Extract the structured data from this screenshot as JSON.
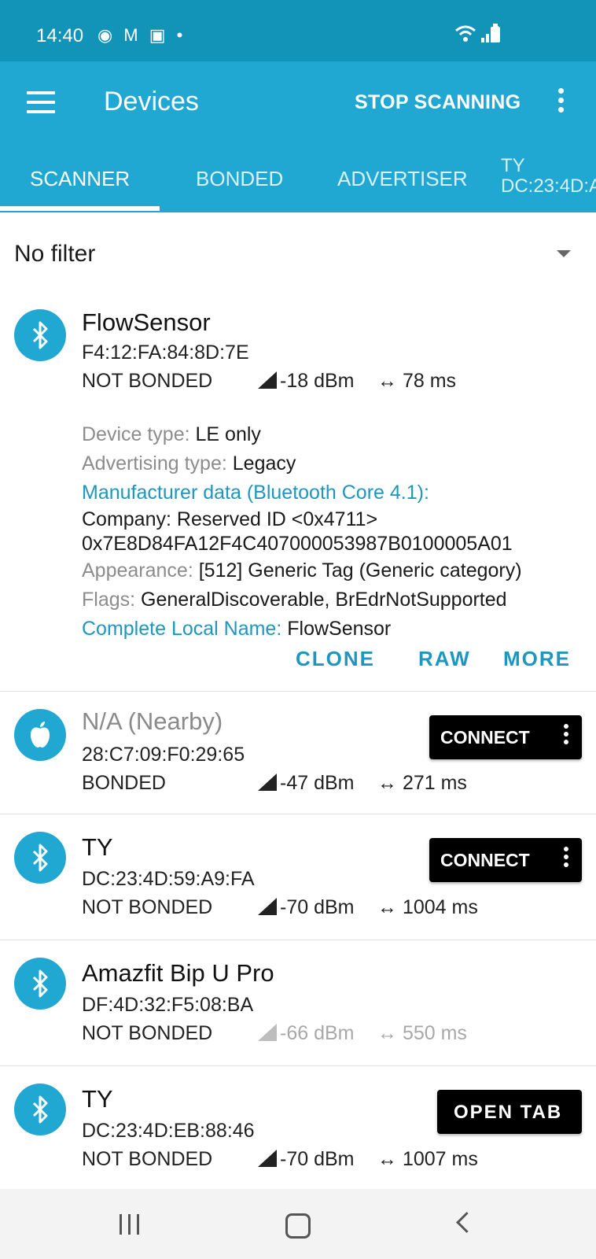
{
  "status_bar": {
    "time": "14:40",
    "left_icons": "◉ M ▣ •"
  },
  "toolbar": {
    "title": "Devices",
    "stop_label": "STOP SCANNING"
  },
  "tabs": [
    {
      "label": "SCANNER"
    },
    {
      "label": "BONDED"
    },
    {
      "label": "ADVERTISER"
    }
  ],
  "device_tab": {
    "name": "TY",
    "address": "DC:23:4D:A"
  },
  "filter": {
    "value": "No filter"
  },
  "devices": [
    {
      "name": "FlowSensor",
      "mac": "F4:12:FA:84:8D:7E",
      "bond": "NOT BONDED",
      "rssi": "-18 dBm",
      "interval": "78 ms",
      "icon": "bluetooth-icon",
      "details": {
        "device_type_label": "Device type:",
        "device_type": "LE only",
        "adv_type_label": "Advertising type:",
        "adv_type": "Legacy",
        "manufacturer_label": "Manufacturer data (Bluetooth Core 4.1):",
        "company": "Company: Reserved ID <0x4711>",
        "mfr_hex": "0x7E8D84FA12F4C407000053987B0100005A01",
        "appearance_label": "Appearance:",
        "appearance": "[512] Generic Tag (Generic category)",
        "flags_label": "Flags:",
        "flags": "GeneralDiscoverable, BrEdrNotSupported",
        "local_name_label": "Complete Local Name:",
        "local_name": "FlowSensor"
      },
      "actions": {
        "clone": "CLONE",
        "raw": "RAW",
        "more": "MORE"
      }
    },
    {
      "name": "N/A  (Nearby)",
      "mac": "28:C7:09:F0:29:65",
      "bond": "BONDED",
      "rssi": "-47 dBm",
      "interval": "271 ms",
      "icon": "apple-icon",
      "button": "CONNECT"
    },
    {
      "name": "TY",
      "mac": "DC:23:4D:59:A9:FA",
      "bond": "NOT BONDED",
      "rssi": "-70 dBm",
      "interval": "1004 ms",
      "icon": "bluetooth-icon",
      "button": "CONNECT"
    },
    {
      "name": "Amazfit Bip U Pro",
      "mac": "DF:4D:32:F5:08:BA",
      "bond": "NOT BONDED",
      "rssi": "-66 dBm",
      "interval": "550 ms",
      "icon": "bluetooth-icon"
    },
    {
      "name": "TY",
      "mac": "DC:23:4D:EB:88:46",
      "bond": "NOT BONDED",
      "rssi": "-70 dBm",
      "interval": "1007 ms",
      "icon": "bluetooth-icon",
      "button": "OPEN TAB"
    }
  ],
  "colors": {
    "accent": "#20a8d3",
    "statusbar": "#1294b8",
    "link": "#1e96bf"
  }
}
